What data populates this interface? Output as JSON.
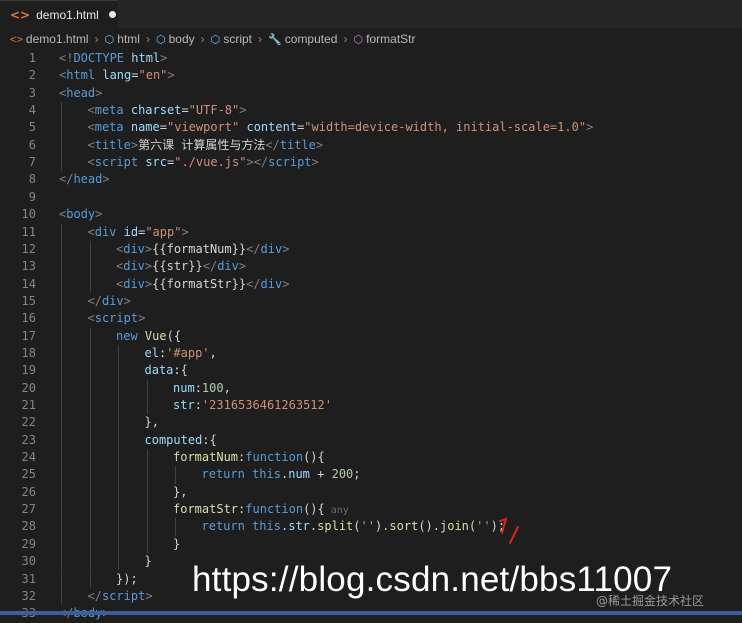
{
  "tab": {
    "icon": "html-file-icon",
    "title": "demo1.html"
  },
  "breadcrumb": [
    {
      "icon": "html-file-icon",
      "label": "demo1.html"
    },
    {
      "icon": "cube-icon",
      "label": "html"
    },
    {
      "icon": "cube-icon",
      "label": "body"
    },
    {
      "icon": "cube-icon",
      "label": "script"
    },
    {
      "icon": "wrench-icon",
      "label": "computed"
    },
    {
      "icon": "purple-cube-icon",
      "label": "formatStr"
    }
  ],
  "lines": [
    {
      "n": "1",
      "indent": 0,
      "tokens": [
        [
          "punct",
          "<!"
        ],
        [
          "tag",
          "DOCTYPE "
        ],
        [
          "attr",
          "html"
        ],
        [
          "punct",
          ">"
        ]
      ]
    },
    {
      "n": "2",
      "indent": 0,
      "tokens": [
        [
          "punct",
          "<"
        ],
        [
          "tag",
          "html "
        ],
        [
          "attr",
          "lang"
        ],
        [
          "text",
          "="
        ],
        [
          "str",
          "\"en\""
        ],
        [
          "punct",
          ">"
        ]
      ]
    },
    {
      "n": "3",
      "indent": 0,
      "tokens": [
        [
          "punct",
          "<"
        ],
        [
          "tag",
          "head"
        ],
        [
          "punct",
          ">"
        ]
      ]
    },
    {
      "n": "4",
      "indent": 1,
      "tokens": [
        [
          "punct",
          "<"
        ],
        [
          "tag",
          "meta "
        ],
        [
          "attr",
          "charset"
        ],
        [
          "text",
          "="
        ],
        [
          "str",
          "\"UTF-8\""
        ],
        [
          "punct",
          ">"
        ]
      ]
    },
    {
      "n": "5",
      "indent": 1,
      "tokens": [
        [
          "punct",
          "<"
        ],
        [
          "tag",
          "meta "
        ],
        [
          "attr",
          "name"
        ],
        [
          "text",
          "="
        ],
        [
          "str",
          "\"viewport\" "
        ],
        [
          "attr",
          "content"
        ],
        [
          "text",
          "="
        ],
        [
          "str",
          "\"width=device-width, initial-scale=1.0\""
        ],
        [
          "punct",
          ">"
        ]
      ]
    },
    {
      "n": "6",
      "indent": 1,
      "tokens": [
        [
          "punct",
          "<"
        ],
        [
          "tag",
          "title"
        ],
        [
          "punct",
          ">"
        ],
        [
          "text",
          "第六课 计算属性与方法"
        ],
        [
          "punct",
          "</"
        ],
        [
          "tag",
          "title"
        ],
        [
          "punct",
          ">"
        ]
      ]
    },
    {
      "n": "7",
      "indent": 1,
      "tokens": [
        [
          "punct",
          "<"
        ],
        [
          "tag",
          "script "
        ],
        [
          "attr",
          "src"
        ],
        [
          "text",
          "="
        ],
        [
          "str",
          "\"./vue.js\""
        ],
        [
          "punct",
          "></"
        ],
        [
          "tag",
          "script"
        ],
        [
          "punct",
          ">"
        ]
      ]
    },
    {
      "n": "8",
      "indent": 0,
      "tokens": [
        [
          "punct",
          "</"
        ],
        [
          "tag",
          "head"
        ],
        [
          "punct",
          ">"
        ]
      ]
    },
    {
      "n": "9",
      "indent": 0,
      "tokens": []
    },
    {
      "n": "10",
      "indent": 0,
      "tokens": [
        [
          "punct",
          "<"
        ],
        [
          "tag",
          "body"
        ],
        [
          "punct",
          ">"
        ]
      ]
    },
    {
      "n": "11",
      "indent": 1,
      "tokens": [
        [
          "punct",
          "<"
        ],
        [
          "tag",
          "div "
        ],
        [
          "attr",
          "id"
        ],
        [
          "text",
          "="
        ],
        [
          "str",
          "\"app\""
        ],
        [
          "punct",
          ">"
        ]
      ]
    },
    {
      "n": "12",
      "indent": 2,
      "tokens": [
        [
          "punct",
          "<"
        ],
        [
          "tag",
          "div"
        ],
        [
          "punct",
          ">"
        ],
        [
          "text",
          "{{formatNum}}"
        ],
        [
          "punct",
          "</"
        ],
        [
          "tag",
          "div"
        ],
        [
          "punct",
          ">"
        ]
      ]
    },
    {
      "n": "13",
      "indent": 2,
      "tokens": [
        [
          "punct",
          "<"
        ],
        [
          "tag",
          "div"
        ],
        [
          "punct",
          ">"
        ],
        [
          "text",
          "{{str}}"
        ],
        [
          "punct",
          "</"
        ],
        [
          "tag",
          "div"
        ],
        [
          "punct",
          ">"
        ]
      ]
    },
    {
      "n": "14",
      "indent": 2,
      "tokens": [
        [
          "punct",
          "<"
        ],
        [
          "tag",
          "div"
        ],
        [
          "punct",
          ">"
        ],
        [
          "text",
          "{{formatStr}}"
        ],
        [
          "punct",
          "</"
        ],
        [
          "tag",
          "div"
        ],
        [
          "punct",
          ">"
        ]
      ]
    },
    {
      "n": "15",
      "indent": 1,
      "tokens": [
        [
          "punct",
          "</"
        ],
        [
          "tag",
          "div"
        ],
        [
          "punct",
          ">"
        ]
      ]
    },
    {
      "n": "16",
      "indent": 1,
      "tokens": [
        [
          "punct",
          "<"
        ],
        [
          "tag",
          "script"
        ],
        [
          "punct",
          ">"
        ]
      ]
    },
    {
      "n": "17",
      "indent": 2,
      "tokens": [
        [
          "kw",
          "new "
        ],
        [
          "fn",
          "Vue"
        ],
        [
          "text",
          "({"
        ]
      ]
    },
    {
      "n": "18",
      "indent": 3,
      "tokens": [
        [
          "prop",
          "el"
        ],
        [
          "text",
          ":"
        ],
        [
          "str",
          "'#app'"
        ],
        [
          "text",
          ","
        ]
      ]
    },
    {
      "n": "19",
      "indent": 3,
      "tokens": [
        [
          "prop",
          "data"
        ],
        [
          "text",
          ":{"
        ]
      ]
    },
    {
      "n": "20",
      "indent": 4,
      "tokens": [
        [
          "prop",
          "num"
        ],
        [
          "text",
          ":"
        ],
        [
          "num",
          "100"
        ],
        [
          "text",
          ","
        ]
      ]
    },
    {
      "n": "21",
      "indent": 4,
      "tokens": [
        [
          "prop",
          "str"
        ],
        [
          "text",
          ":"
        ],
        [
          "str",
          "'2316536461263512'"
        ]
      ]
    },
    {
      "n": "22",
      "indent": 3,
      "tokens": [
        [
          "text",
          "},"
        ]
      ]
    },
    {
      "n": "23",
      "indent": 3,
      "tokens": [
        [
          "prop",
          "computed"
        ],
        [
          "text",
          ":{"
        ]
      ]
    },
    {
      "n": "24",
      "indent": 4,
      "tokens": [
        [
          "fn",
          "formatNum"
        ],
        [
          "text",
          ":"
        ],
        [
          "kw",
          "function"
        ],
        [
          "text",
          "(){"
        ]
      ]
    },
    {
      "n": "25",
      "indent": 5,
      "tokens": [
        [
          "kw",
          "return "
        ],
        [
          "kw",
          "this"
        ],
        [
          "text",
          "."
        ],
        [
          "prop",
          "num"
        ],
        [
          "text",
          " + "
        ],
        [
          "num",
          "200"
        ],
        [
          "text",
          ";"
        ]
      ]
    },
    {
      "n": "26",
      "indent": 4,
      "tokens": [
        [
          "text",
          "},"
        ]
      ]
    },
    {
      "n": "27",
      "indent": 4,
      "tokens": [
        [
          "fn",
          "formatStr"
        ],
        [
          "text",
          ":"
        ],
        [
          "kw",
          "function"
        ],
        [
          "text",
          "(){"
        ],
        [
          "note",
          " any"
        ]
      ]
    },
    {
      "n": "28",
      "indent": 5,
      "tokens": [
        [
          "kw",
          "return "
        ],
        [
          "kw",
          "this"
        ],
        [
          "text",
          "."
        ],
        [
          "prop",
          "str"
        ],
        [
          "text",
          "."
        ],
        [
          "fn",
          "split"
        ],
        [
          "text",
          "("
        ],
        [
          "str",
          "''"
        ],
        [
          "text",
          ")."
        ],
        [
          "fn",
          "sort"
        ],
        [
          "text",
          "()."
        ],
        [
          "fn",
          "join"
        ],
        [
          "text",
          "("
        ],
        [
          "str",
          "''"
        ],
        [
          "text",
          ");"
        ]
      ]
    },
    {
      "n": "29",
      "indent": 4,
      "tokens": [
        [
          "text",
          "}"
        ]
      ]
    },
    {
      "n": "30",
      "indent": 3,
      "tokens": [
        [
          "text",
          "}"
        ]
      ]
    },
    {
      "n": "31",
      "indent": 2,
      "tokens": [
        [
          "text",
          "});"
        ]
      ]
    },
    {
      "n": "32",
      "indent": 1,
      "tokens": [
        [
          "punct",
          "</"
        ],
        [
          "tag",
          "script"
        ],
        [
          "punct",
          ">"
        ]
      ]
    },
    {
      "n": "33",
      "indent": 0,
      "tokens": [
        [
          "punct",
          "</"
        ],
        [
          "tag",
          "body"
        ],
        [
          "punct",
          ">"
        ]
      ]
    }
  ],
  "watermark": "https://blog.csdn.net/bbs11007",
  "watermark_small": "@稀土掘金技术社区",
  "colors": {
    "editor_bg": "#1e1e1e",
    "tag": "#569cd6",
    "attr": "#9cdcfe",
    "string": "#ce9178",
    "function": "#dcdcaa",
    "number": "#b5cea8"
  }
}
